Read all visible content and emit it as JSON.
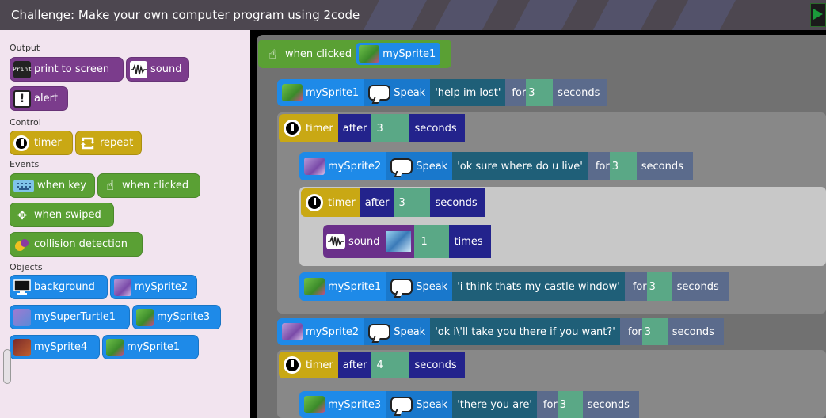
{
  "title": "Challenge: Make your own computer program using 2code",
  "palette": {
    "categories": {
      "output": "Output",
      "control": "Control",
      "events": "Events",
      "objects": "Objects"
    },
    "output": {
      "print_icon": "Print",
      "print_label": "print to screen",
      "sound_label": "sound",
      "alert_label": "alert"
    },
    "control": {
      "timer_label": "timer",
      "repeat_label": "repeat"
    },
    "events": {
      "when_key_label": "when key",
      "when_clicked_label": "when clicked",
      "when_swiped_label": "when swiped",
      "collision_label": "collision detection"
    },
    "objects": {
      "background_label": "background",
      "mysprite2_label": "mySprite2",
      "mysuperturtle1_label": "mySuperTurtle1",
      "mysprite3_label": "mySprite3",
      "mysprite4_label": "mySprite4",
      "mysprite1_label": "mySprite1"
    }
  },
  "script": {
    "event": {
      "label": "when clicked",
      "sprite": "mySprite1"
    },
    "speak1": {
      "sprite": "mySprite1",
      "speak": "Speak",
      "text": "'help im lost'",
      "for": "for",
      "value": "3",
      "unit": "seconds"
    },
    "timer1": {
      "label": "timer",
      "after": "after",
      "value": "3",
      "unit": "seconds"
    },
    "speak2": {
      "sprite": "mySprite2",
      "speak": "Speak",
      "text": "'ok sure where do u live'",
      "for": "for",
      "value": "3",
      "unit": "seconds"
    },
    "timer2": {
      "label": "timer",
      "after": "after",
      "value": "3",
      "unit": "seconds"
    },
    "sound1": {
      "label": "sound",
      "value": "1",
      "unit": "times"
    },
    "speak3": {
      "sprite": "mySprite1",
      "speak": "Speak",
      "text": "'i think thats my castle window'",
      "for": "for",
      "value": "3",
      "unit": "seconds"
    },
    "speak4": {
      "sprite": "mySprite2",
      "speak": "Speak",
      "text": "'ok i\\'ll take you there if you want?'",
      "for": "for",
      "value": "3",
      "unit": "seconds"
    },
    "timer3": {
      "label": "timer",
      "after": "after",
      "value": "4",
      "unit": "seconds"
    },
    "speak5": {
      "sprite": "mySprite3",
      "speak": "Speak",
      "text": "'there you are'",
      "for": "for",
      "value": "3",
      "unit": "seconds"
    }
  }
}
